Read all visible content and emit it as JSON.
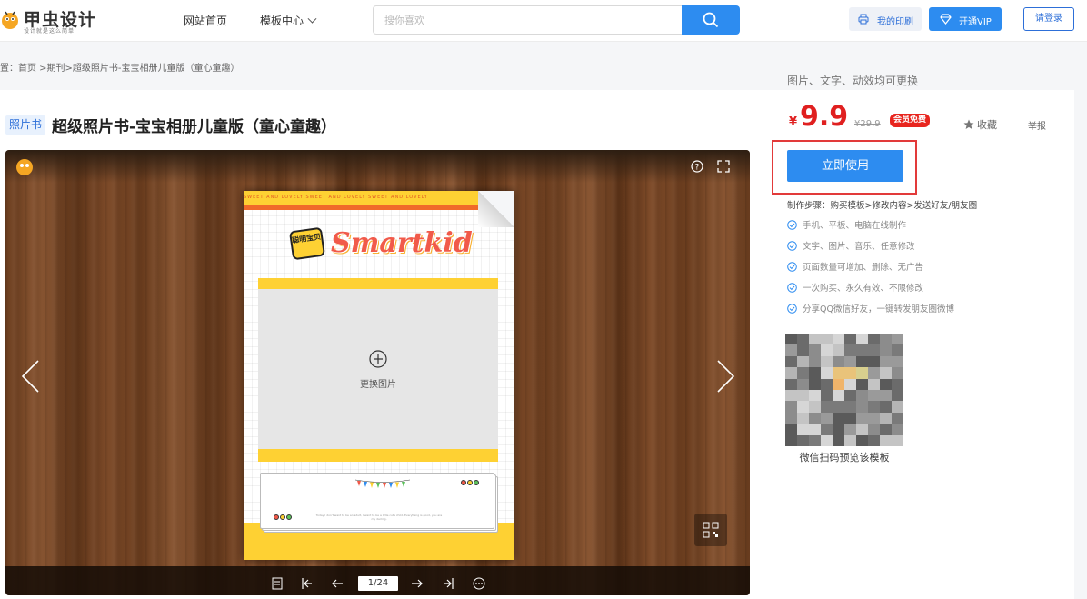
{
  "header": {
    "logo_title": "甲虫设计",
    "logo_subtitle": "设计就是这么简单",
    "nav_home": "网站首页",
    "nav_templates": "模板中心",
    "search_placeholder": "搜你喜欢",
    "print_label": "我的印刷",
    "vip_label": "开通VIP",
    "login_label": "请登录"
  },
  "breadcrumb": "置：首页 >期刊>超级照片书-宝宝相册儿童版（童心童趣）",
  "product": {
    "tag": "照片书",
    "title": "超级照片书-宝宝相册儿童版（童心童趣）",
    "report": "举报"
  },
  "preview": {
    "strip_text": "SWEET AND LOVELY          SWEET AND LOVELY          SWEET AND LOVELY",
    "badge_text": "聪明宝贝",
    "headline": "Smartkid",
    "replace_label": "更换图片",
    "page_counter": "1/24",
    "tiny_text": "Today I don't want to be an adult, I want to be a little cute child. Everything is good, you are my darling."
  },
  "sidebar": {
    "editable_note": "图片、文字、动效均可更换",
    "currency": "¥",
    "price": "9.9",
    "old_price": "¥29.9",
    "vip_badge": "会员免费",
    "favorite": "收藏",
    "use_button": "立即使用",
    "steps": "制作步骤：购买模板>修改内容>发送好友/朋友圈",
    "features": [
      "手机、平板、电脑在线制作",
      "文字、图片、音乐、任意修改",
      "页面数量可增加、删除、无广告",
      "一次购买、永久有效、不限修改",
      "分享QQ微信好友，一键转发朋友圈微博"
    ],
    "qr_caption": "微信扫码预览该模板"
  },
  "colors": {
    "accent": "#2d8cf0",
    "price": "#e02020",
    "highlight_border": "#e23a3a"
  }
}
